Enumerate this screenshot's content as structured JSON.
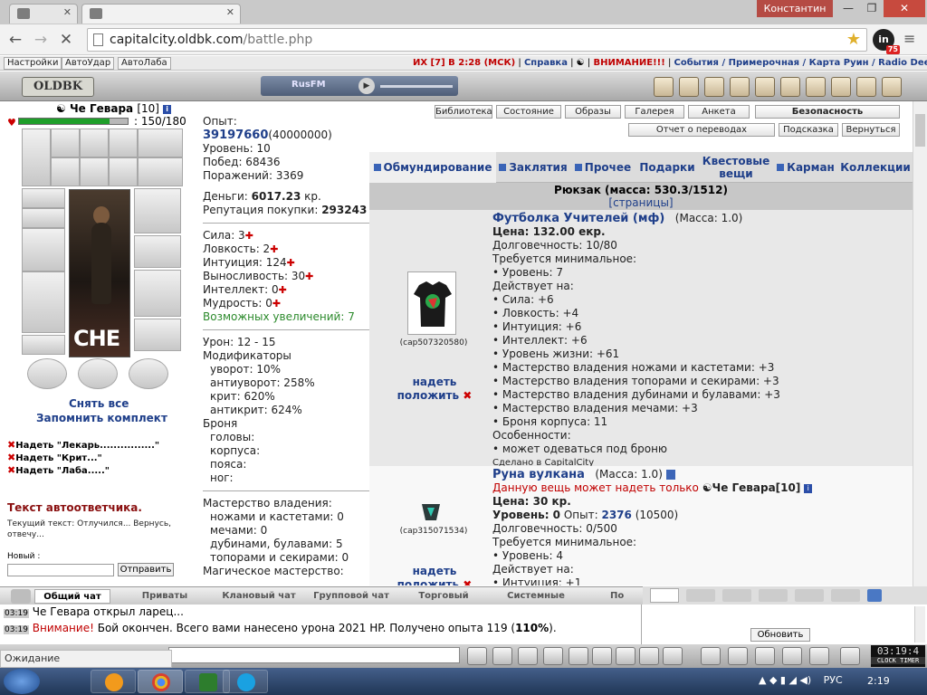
{
  "browser": {
    "user": "Константин",
    "url_host": "capitalcity.oldbk.com",
    "url_path": "/battle.php",
    "ext_badge": "75",
    "status": "Ожидание capitalcity.oldbk.com..."
  },
  "topbar": {
    "buttons": [
      "Настройки",
      "АвтоУдар",
      "АвтоЛаба"
    ],
    "battle": "ИХ [7] В 2:28 (МСК)",
    "help": "Справка",
    "attention": "ВНИМАНИЕ!!!",
    "links": "События / Примерочная / Карта Руин / Radio DeepFm"
  },
  "banner": {
    "logo": "OLDBK",
    "radio": "RusFM"
  },
  "character": {
    "name": "Че Гевара",
    "level": "[10]",
    "hp": ": 150/180",
    "hp_fraction": 0.833,
    "portrait_text": "CHE",
    "undress_all": "Снять все",
    "save_kit": "Запомнить комплект",
    "kits": [
      "Надеть \"Лекарь................\"",
      "Надеть \"Крит...\"",
      "Надеть \"Лаба.....\""
    ]
  },
  "autoanswer": {
    "title": "Текст автоответчика.",
    "current": "Текущий текст: Отлучился... Вернусь, отвечу...",
    "new_label": "Новый :",
    "send": "Отправить"
  },
  "stats": {
    "exp_label": "Опыт:",
    "exp_value": "39197660",
    "exp_next": "(40000000)",
    "level": "Уровень: 10",
    "wins": "Побед: 68436",
    "losses": "Поражений: 3369",
    "money_label": "Деньги: ",
    "money_value": "6017.23",
    "money_unit": " кр.",
    "rep_label": "Репутация покупки: ",
    "rep_value": "293243",
    "attrs": [
      "Сила: 3",
      "Ловкость: 2",
      "Интуиция: 124",
      "Выносливость: 30",
      "Интеллект: 0",
      "Мудрость: 0"
    ],
    "increases": "Возможных увеличений: 7",
    "damage": "Урон: 12 - 15",
    "mods_label": "Модификаторы",
    "mods": [
      "уворот:  10%",
      "антиуворот:  258%",
      "крит:  620%",
      "антикрит:  624%"
    ],
    "armor_label": "Броня",
    "armor": [
      "головы:",
      "корпуса:",
      "пояса:",
      "ног:"
    ],
    "mastery_label": "Мастерство владения:",
    "mastery": [
      "ножами и кастетами: 0",
      "мечами: 0",
      "дубинами, булавами: 5",
      "топорами и секирами: 0"
    ],
    "magic_label": "Магическое мастерство:"
  },
  "right": {
    "buttons_row1": [
      "Библиотека",
      "Состояние",
      "Образы",
      "Галерея",
      "Анкета",
      "Безопасность"
    ],
    "buttons_row2": [
      "Отчет о переводах",
      "Подсказка",
      "Вернуться"
    ],
    "tabs": [
      "Обмундирование",
      "Заклятия",
      "Прочее",
      "Подарки",
      "Квестовые вещи",
      "Карман",
      "Коллекции"
    ],
    "rucksack": "Рюкзак (масса: 530.3/1512)",
    "pages": "[страницы]"
  },
  "items": [
    {
      "name": "Футболка Учителей (мф)",
      "mass": "(Масса: 1.0)",
      "code": "(cap507320580)",
      "wear": "надеть",
      "put": "положить",
      "price": "Цена: 132.00 екр.",
      "lines": [
        "Долговечность: 10/80",
        "Требуется минимальное:",
        "• Уровень: 7",
        "Действует на:",
        "• Сила: +6",
        "• Ловкость: +4",
        "• Интуиция: +6",
        "• Интеллект: +6",
        "• Уровень жизни: +61",
        "• Мастерство владения ножами и кастетами: +3",
        "• Мастерство владения топорами и секирами: +3",
        "• Мастерство владения дубинами и булавами: +3",
        "• Мастерство владения мечами: +3",
        "• Броня корпуса: 11",
        "Особенности:",
        "• может одеваться под броню"
      ],
      "made": "Сделано в CapitalCity"
    },
    {
      "name": "Руна вулкана",
      "mass": "(Масса: 1.0)",
      "code": "(cap315071534)",
      "wear": "надеть",
      "put": "положить",
      "owner_note": "Данную вещь может надеть только",
      "owner": "Че Гевара[10]",
      "price": "Цена: 30 кр.",
      "level_line": "Уровень: 0",
      "exp_label": " Опыт: ",
      "exp_value": "2376",
      "exp_next": " (10500)",
      "lines": [
        "Долговечность: 0/500",
        "Требуется минимальное:",
        "• Уровень: 4",
        "Действует на:",
        "• Интуиция: +1"
      ]
    }
  ],
  "chat": {
    "tabs": [
      "Общий чат",
      "Приваты",
      "Клановый чат",
      "Групповой чат",
      "Торговый",
      "Системные",
      "По"
    ],
    "log": [
      {
        "time": "03:19",
        "text": "Че Гевара открыл ларец..."
      },
      {
        "time": "03:19",
        "warn": "Внимание!",
        "text": " Бой окончен. Всего вами нанесено урона 2021 HP. Получено опыта 119 (",
        "pct": "110%",
        "tail": ")."
      }
    ],
    "refresh": "Обновить",
    "clock": "03:19:4",
    "clock_label": "CLOCK TIMER"
  },
  "taskbar": {
    "lang": "РУС",
    "time": "2:19"
  }
}
